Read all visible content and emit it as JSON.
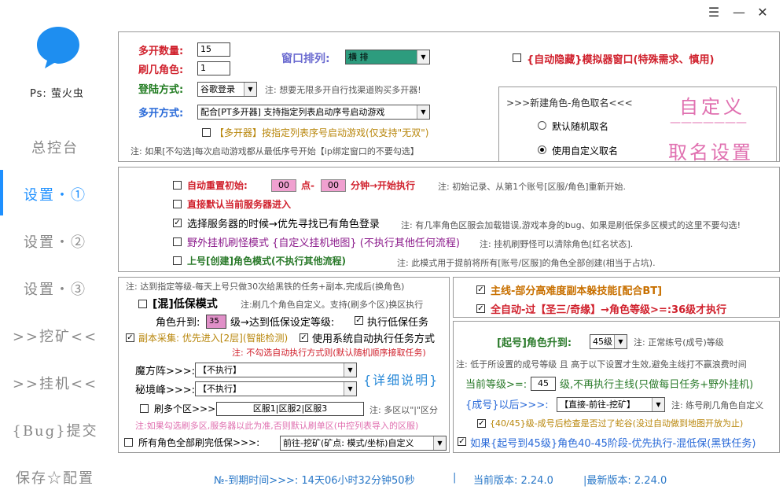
{
  "window": {
    "min": "—",
    "max": "☰",
    "close": "✕"
  },
  "sidebar": {
    "ps": "Ps: 萤火虫",
    "items": [
      "总控台",
      "设置・①",
      "设置・②",
      "设置・③",
      ">>挖矿<<",
      ">>挂机<<",
      "{Bug}提交",
      "保存☆配置"
    ],
    "active_index": 1
  },
  "top": {
    "count_label": "多开数量:",
    "count_value": "15",
    "brush_label": "刷几角色:",
    "brush_value": "1",
    "login_label": "登陆方式:",
    "login_value": "谷歌登录",
    "login_note": "注: 想要无限多开自行找渠道购买多开器!",
    "multi_label": "多开方式:",
    "multi_value": "配合[PT多开器] 支持指定列表启动序号启动游戏",
    "multi_check_label": "【多开器】按指定列表序号启动游戏(仅支持\"无双\")",
    "multi_note": "注: 如果[不勾选]每次启动游戏都从最低序号开始【ip绑定窗口的不要勾选】",
    "arrange_label": "窗口排列:",
    "arrange_value": "横 排",
    "hide_label": "{自动隐藏}模拟器窗口(特殊需求、慎用)"
  },
  "naming": {
    "title": ">>>新建角色-角色取名<<<",
    "opt_random": "默认随机取名",
    "opt_custom": "使用自定义取名",
    "big1": "自定义",
    "big_line": "———————",
    "big2": "取名设置"
  },
  "mid": {
    "reset_label": "自动重置初始:",
    "reset_h": "00",
    "reset_mid": "点-",
    "reset_m": "00",
    "reset_tail": "分钟→开始执行",
    "reset_note": "注: 初始记录、从第1个账号[区服/角色]重新开始.",
    "direct_label": "直接默认当前服务器进入",
    "server_label": "选择服务器的时候→优先寻找已有角色登录",
    "server_note": "注: 有几率角色区服会加载错误,游戏本身的bug、如果是刷低保多区模式的这里不要勾选!",
    "field_label": "野外挂机刷怪模式 {自定义挂机地图} (不执行其他任何流程)",
    "field_note": "注: 挂机刷野怪可以清除角色[红名状态].",
    "create_label": "上号[创建]角色模式(不执行其他流程)",
    "create_note": "注: 此模式用于提前将所有[账号/区服]的角色全部创建(相当于占坑)."
  },
  "low": {
    "note_top": "注: 达到指定等级-每天上号只做30次给黑铁的任务+副本,完成后(换角色)",
    "mode_label": "[混]低保模式",
    "mode_note": "注:刷几个角色自定义。支持(刷多个区)换区执行",
    "level_label": "角色升到:",
    "level_value": "35",
    "level_tail": "级→达到低保设定等级:",
    "exec_label": "执行低保任务",
    "dungeon_label": "副本采集: 优先进入[2层](智能检测)",
    "sys_label": "使用系统自动执行任务方式",
    "sys_note": "注: 不勾选自动执行方式则(默认随机顺序接取任务)",
    "demon_label": "魔方阵>>>:",
    "demon_value": "【不执行】",
    "peak_label": "秘境峰>>>:",
    "peak_value": "【不执行】",
    "detail": "{详细说明}",
    "multi_zone_label": "刷多个区>>>:",
    "multi_zone_value": "区服1|区服2|区服3",
    "multi_zone_note": "注: 多区以\"|\"区分",
    "zone_warn": "注:如果勾选刷多区,服务器以此为准,否则默认刷单区(中控列表导入的区服)",
    "all_label": "所有角色全部刷完低保>>>:",
    "all_value": "前往-挖矿(矿点: 模式/坐标)自定义"
  },
  "right": {
    "main_label": "主线-部分高难度副本躲技能[配合BT]",
    "auto_label": "全自动-过【圣三/奇缘】→角色等级>=:36级才执行",
    "start_label": "[起号]角色升到:",
    "start_value": "45级",
    "start_note": "注: 正常练号(成号)等级",
    "start_note2": "注: 低于所设置的成号等级 且 高于以下设置才生效,避免主线打不赢浪费时间",
    "cur_label": "当前等级>=:",
    "cur_value": "45",
    "cur_tail": "级,不再执行主线(只做每日任务+野外挂机)",
    "after_label": "{成号}以后>>>:",
    "after_value": "【直接-前往-挖矿】",
    "after_note": "注: 练号刷几角色自定义",
    "snake_label": "{40/45}级-成号后检查是否过了蛇谷(没过自动做到地图开放为止)",
    "start45_label": "如果{起号到45级}角色40-45阶段-优先执行-混低保(黑铁任务)"
  },
  "footer": {
    "expire": "№-到期时间>>>: 14天06小时32分钟50秒",
    "sep": "|",
    "cur_ver": "当前版本: 2.24.0",
    "new_ver": "|最新版本: 2.24.0"
  },
  "colors": {
    "accent": "#1e90ff",
    "red": "#d0202c",
    "pink": "#e070b0"
  }
}
